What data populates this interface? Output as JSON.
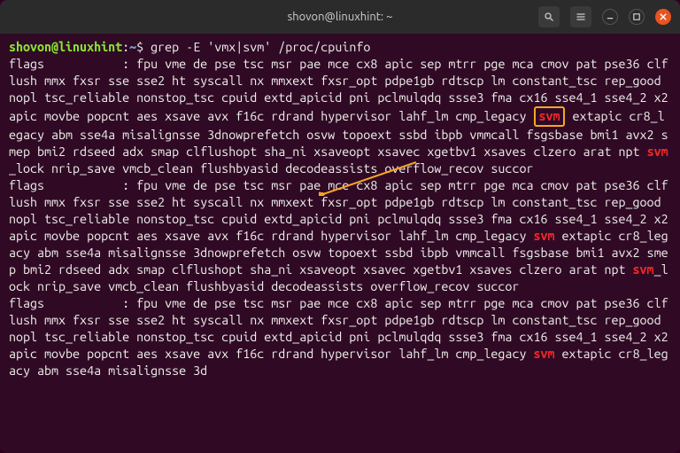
{
  "titlebar": {
    "title": "shovon@linuxhint: ~"
  },
  "prompt": {
    "user_host": "shovon@linuxhint",
    "sep": ":",
    "path": "~",
    "symbol": "$ ",
    "command": "grep -E 'vmx|svm' /proc/cpuinfo"
  },
  "highlight_word": "svm",
  "flags_block": {
    "prefix": "flags           : ",
    "before_svm": "fpu vme de pse tsc msr pae mce cx8 apic sep mtrr pge mca cmov pat pse36 clflush mmx fxsr sse sse2 ht syscall nx mmxext fxsr_opt pdpe1gb rdtscp lm constant_tsc rep_good nopl tsc_reliable nonstop_tsc cpuid extd_apicid pni pclmulqdq ssse3 fma cx16 sse4_1 sse4_2 x2apic movbe popcnt aes xsave avx f16c rdrand hypervisor lahf_lm cmp_legacy ",
    "after_svm_before_svm2": " extapic cr8_legacy abm sse4a misalignsse 3dnowprefetch osvw topoext ssbd ibpb vmmcall fsgsbase bmi1 avx2 smep bmi2 rdseed adx smap clflushopt sha_ni xsaveopt xsavec xgetbv1 xsaves clzero arat npt ",
    "svm2": "svm",
    "after_svm2": "_lock nrip_save vmcb_clean flushbyasid decodeassists overflow_recov succor"
  },
  "block3_partial": {
    "before_svm": "flags           : fpu vme de pse tsc msr pae mce cx8 apic sep mtrr pge mca cmov pat pse36 clflush mmx fxsr sse sse2 ht syscall nx mmxext fxsr_opt pdpe1gb rdtscp lm constant_tsc rep_good nopl tsc_reliable nonstop_tsc cpuid extd_apicid pni pclmulqdq ssse3 fma cx16 sse4_1 sse4_2 x2apic movbe popcnt aes xsave avx f16c rdrand hypervisor lahf_lm cmp_legacy ",
    "after_svm": " extapic cr8_legacy abm sse4a misalignsse 3d"
  }
}
